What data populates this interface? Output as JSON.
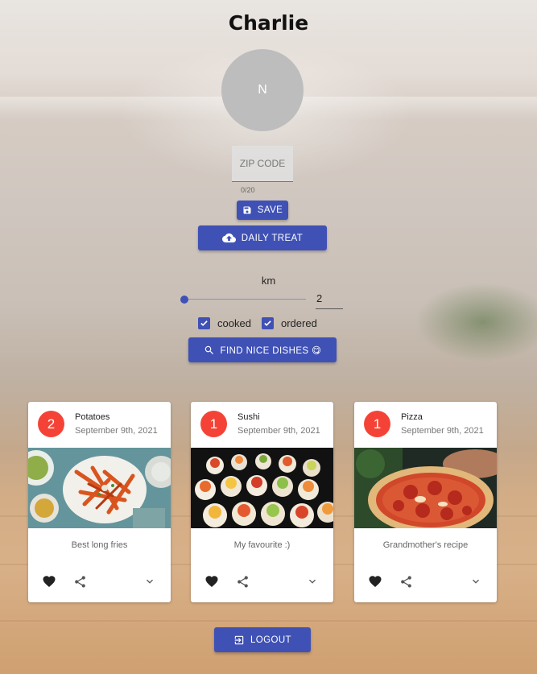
{
  "profile": {
    "name": "Charlie",
    "avatar_initial": "N",
    "zip_placeholder": "ZIP CODE",
    "zip_value": "",
    "zip_counter": "0/20"
  },
  "actions": {
    "save_label": "Save",
    "daily_treat_label": "Daily treat",
    "find_label": "Find nice dishes 😋",
    "logout_label": "Logout"
  },
  "filters": {
    "distance_label": "km",
    "distance_value": "2",
    "cooked_label": "cooked",
    "cooked_checked": true,
    "ordered_label": "ordered",
    "ordered_checked": true
  },
  "icons": {
    "save": "save-icon",
    "daily_treat": "cloud-upload-icon",
    "find": "search-icon",
    "logout": "exit-icon",
    "like": "heart-icon",
    "share": "share-icon",
    "expand": "chevron-down-icon"
  },
  "colors": {
    "primary": "#3f51b5",
    "badge": "#f44336"
  },
  "dishes": [
    {
      "count": "2",
      "name": "Potatoes",
      "date": "September 9th, 2021",
      "description": "Best long fries"
    },
    {
      "count": "1",
      "name": "Sushi",
      "date": "September 9th, 2021",
      "description": "My favourite :)"
    },
    {
      "count": "1",
      "name": "Pizza",
      "date": "September 9th, 2021",
      "description": "Grandmother's recipe"
    }
  ]
}
